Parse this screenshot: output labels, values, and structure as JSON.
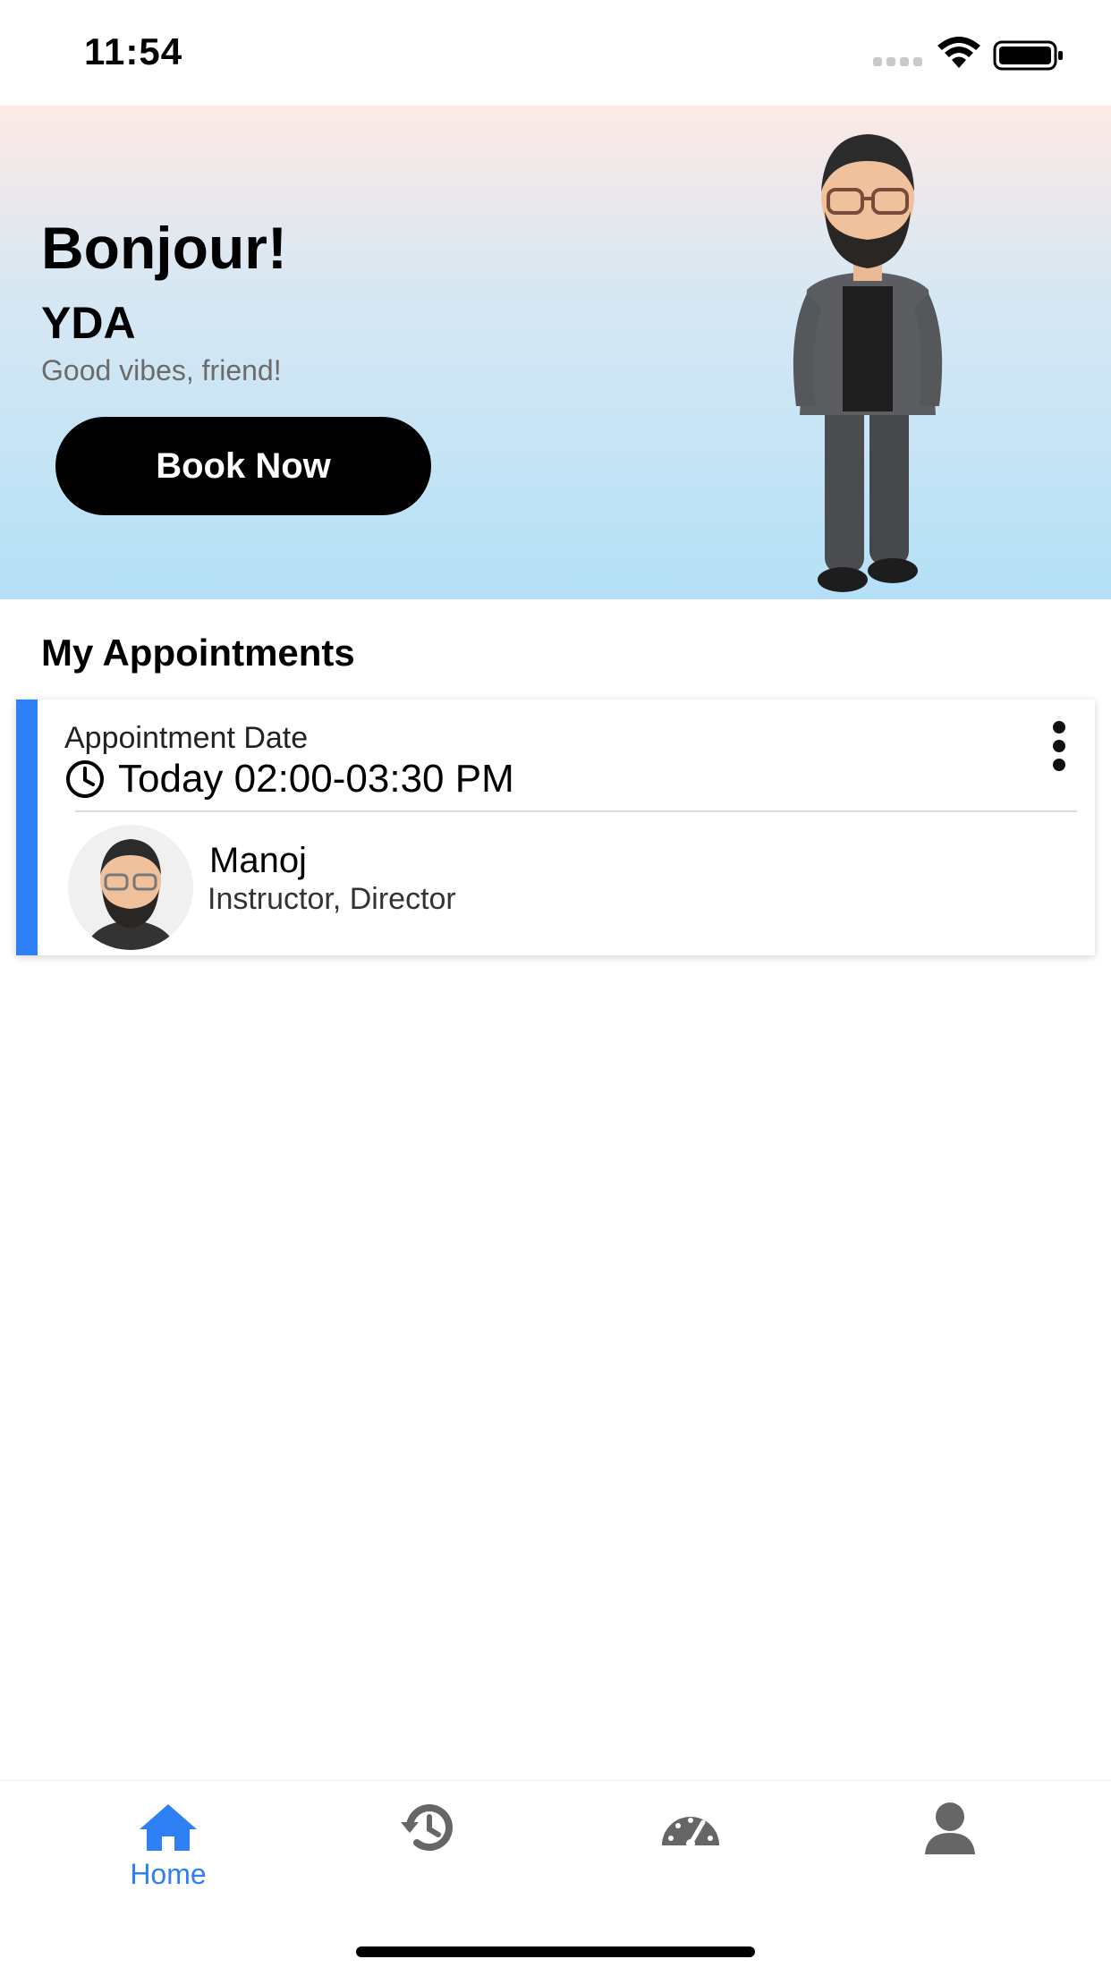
{
  "status_bar": {
    "time": "11:54"
  },
  "hero": {
    "greeting": "Bonjour!",
    "user_name": "YDA",
    "tagline": "Good vibes, friend!",
    "book_button_label": "Book Now"
  },
  "appointments": {
    "section_title": "My Appointments",
    "items": [
      {
        "date_label": "Appointment Date",
        "time": "Today 02:00-03:30 PM",
        "instructor_name": "Manoj",
        "instructor_role": "Instructor, Director"
      }
    ]
  },
  "tab_bar": {
    "tabs": [
      {
        "icon": "home-icon",
        "label": "Home",
        "active": true
      },
      {
        "icon": "history-icon",
        "label": "",
        "active": false
      },
      {
        "icon": "dashboard-icon",
        "label": "",
        "active": false
      },
      {
        "icon": "profile-icon",
        "label": "",
        "active": false
      }
    ]
  },
  "colors": {
    "accent": "#2f7ff5",
    "inactive_icon": "#666666",
    "button": "#000000"
  }
}
